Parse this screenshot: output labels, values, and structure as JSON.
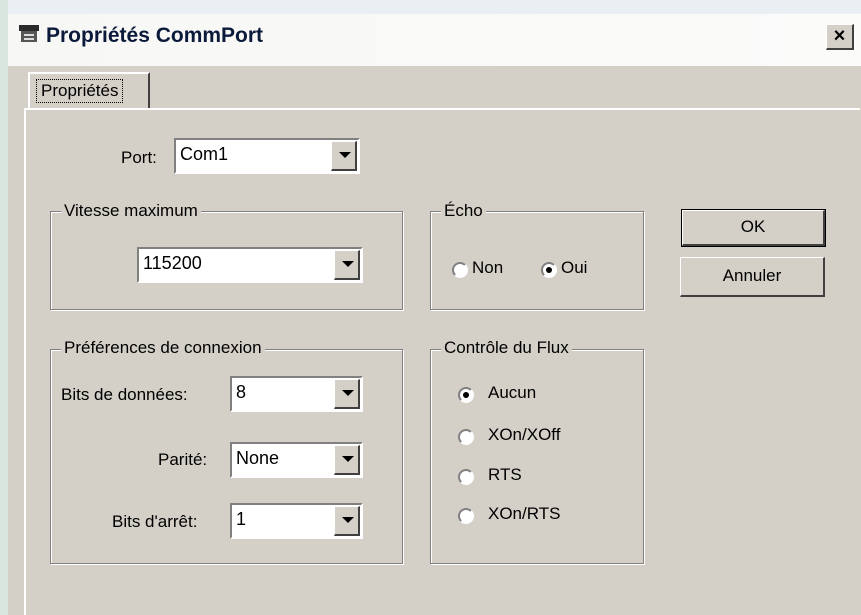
{
  "window": {
    "title": "Propriétés CommPort",
    "close_glyph": "×",
    "app_icon": "phone-icon"
  },
  "tabs": [
    {
      "label": "Propriétés"
    }
  ],
  "port": {
    "label": "Port:",
    "value": "Com1"
  },
  "vitesse": {
    "title": "Vitesse maximum",
    "value": "115200"
  },
  "echo": {
    "title": "Écho",
    "options": [
      {
        "label": "Non",
        "selected": false
      },
      {
        "label": "Oui",
        "selected": true
      }
    ]
  },
  "connexion": {
    "title": "Préférences de connexion",
    "data_bits": {
      "label": "Bits de données:",
      "value": "8"
    },
    "parity": {
      "label": "Parité:",
      "value": "None"
    },
    "stop_bits": {
      "label": "Bits d'arrêt:",
      "value": "1"
    }
  },
  "flux": {
    "title": "Contrôle du Flux",
    "options": [
      {
        "label": "Aucun",
        "selected": true
      },
      {
        "label": "XOn/XOff",
        "selected": false
      },
      {
        "label": "RTS",
        "selected": false
      },
      {
        "label": "XOn/RTS",
        "selected": false
      }
    ]
  },
  "buttons": {
    "ok": "OK",
    "cancel": "Annuler"
  }
}
